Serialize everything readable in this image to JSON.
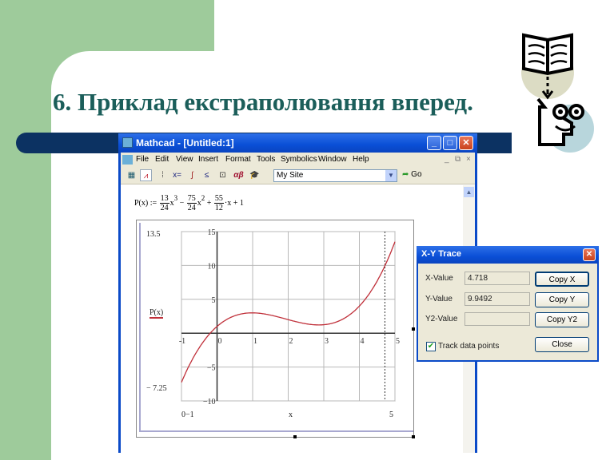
{
  "slide": {
    "title": "6. Приклад екстраполювання вперед.",
    "colors": {
      "green_panel": "#9ecb9b",
      "title_text": "#1b5e5a",
      "accent_bar": "#0c3262"
    }
  },
  "mathcad": {
    "window_title": "Mathcad - [Untitled:1]",
    "window_buttons": {
      "minimize": "_",
      "maximize": "□",
      "close": "✕"
    },
    "menu": [
      "File",
      "Edit",
      "View",
      "Insert",
      "Format",
      "Tools",
      "Symbolics",
      "Window",
      "Help"
    ],
    "doc_controls": {
      "minimize": "_",
      "restore": "⧉",
      "close": "×"
    },
    "toolbar": {
      "icons": [
        "calculator-icon",
        "graph-icon",
        "matrix-icon",
        "evaluation-icon",
        "calculus-icon",
        "boolean-icon",
        "programming-icon",
        "greek-icon",
        "symbolic-icon"
      ],
      "icon_glyphs": [
        "▦",
        "⩘",
        "⁞",
        "x=",
        "∫",
        "≤",
        "⊡",
        "αβ",
        "🎓"
      ],
      "site_value": "My Site",
      "go_label": "Go"
    },
    "formula": {
      "lhs": "P(x) :=",
      "terms": [
        {
          "num": "13",
          "den": "24",
          "var": "x",
          "pow": "3",
          "sign": ""
        },
        {
          "num": "75",
          "den": "24",
          "var": "x",
          "pow": "2",
          "sign": "−"
        },
        {
          "num": "55",
          "den": "12",
          "var": "·x",
          "pow": "",
          "sign": "+"
        }
      ],
      "tail": "+ 1"
    }
  },
  "chart_data": {
    "type": "line",
    "title": "",
    "xlabel": "x",
    "ylabel": "P(x)",
    "function": "P(x) = 13/24·x^3 − 75/24·x^2 + 55/12·x + 1",
    "coefficients": {
      "a3": 0.541667,
      "a2": -3.125,
      "a1": 4.583333,
      "a0": 1
    },
    "xlim": [
      -1,
      5
    ],
    "ylim": [
      -10,
      15
    ],
    "x_ticks": [
      "-1",
      "0",
      "1",
      "2",
      "3",
      "4",
      "5"
    ],
    "y_ticks": [
      "15",
      "10",
      "5",
      "-5",
      "-10"
    ],
    "y_ticks_values": [
      15,
      10,
      5,
      -5,
      -10
    ],
    "x_ticks_values": [
      -1,
      0,
      1,
      2,
      3,
      4,
      5
    ],
    "grid": true,
    "y_range_labels": {
      "top": "13.5",
      "bottom": "− 7.25"
    },
    "x_range_labels": {
      "left": "0−1",
      "right": "5"
    },
    "trace_x": 4.718,
    "series": [
      {
        "name": "P(x)",
        "color": "#c0303a"
      }
    ]
  },
  "xy_trace": {
    "title": "X-Y Trace",
    "close_glyph": "✕",
    "x_label": "X-Value",
    "x_value": "4.718",
    "y_label": "Y-Value",
    "y_value": "9.9492",
    "y2_label": "Y2-Value",
    "y2_value": "",
    "copy_x": "Copy X",
    "copy_y": "Copy Y",
    "copy_y2": "Copy Y2",
    "close": "Close",
    "track_label": "Track data points",
    "track_checked": true
  }
}
